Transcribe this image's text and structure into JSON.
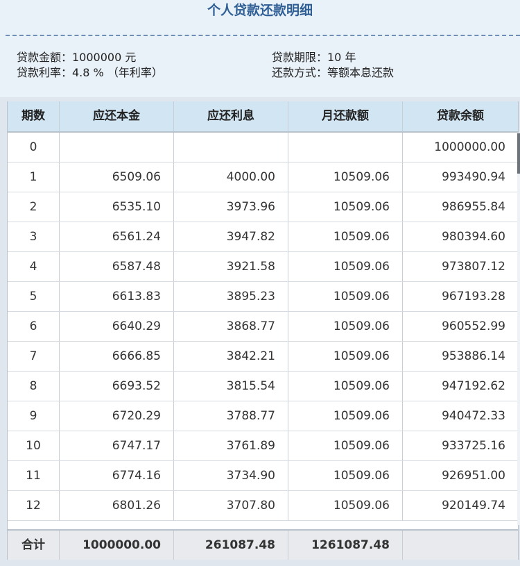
{
  "page": {
    "title": "个人贷款还款明细"
  },
  "info": {
    "amount": "贷款金额：1000000 元",
    "rate": "贷款利率：4.8 % （年利率）",
    "term": "贷款期限：10 年",
    "method": "还款方式：等额本息还款"
  },
  "table": {
    "headers": [
      "期数",
      "应还本金",
      "应还利息",
      "月还款额",
      "贷款余额"
    ],
    "rows": [
      [
        "0",
        "",
        "",
        "",
        "1000000.00"
      ],
      [
        "1",
        "6509.06",
        "4000.00",
        "10509.06",
        "993490.94"
      ],
      [
        "2",
        "6535.10",
        "3973.96",
        "10509.06",
        "986955.84"
      ],
      [
        "3",
        "6561.24",
        "3947.82",
        "10509.06",
        "980394.60"
      ],
      [
        "4",
        "6587.48",
        "3921.58",
        "10509.06",
        "973807.12"
      ],
      [
        "5",
        "6613.83",
        "3895.23",
        "10509.06",
        "967193.28"
      ],
      [
        "6",
        "6640.29",
        "3868.77",
        "10509.06",
        "960552.99"
      ],
      [
        "7",
        "6666.85",
        "3842.21",
        "10509.06",
        "953886.14"
      ],
      [
        "8",
        "6693.52",
        "3815.54",
        "10509.06",
        "947192.62"
      ],
      [
        "9",
        "6720.29",
        "3788.77",
        "10509.06",
        "940472.33"
      ],
      [
        "10",
        "6747.17",
        "3761.89",
        "10509.06",
        "933725.16"
      ],
      [
        "11",
        "6774.16",
        "3734.90",
        "10509.06",
        "926951.00"
      ],
      [
        "12",
        "6801.26",
        "3707.80",
        "10509.06",
        "920149.74"
      ]
    ],
    "footer": [
      "合计",
      "1000000.00",
      "261087.48",
      "1261087.48",
      ""
    ]
  }
}
